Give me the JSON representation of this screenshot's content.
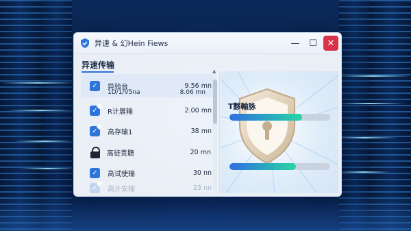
{
  "window": {
    "title": "异速 & 幻Hein Fiews",
    "controls": {
      "minimize": "—",
      "maximize": "☐",
      "close": "✕"
    }
  },
  "section": {
    "title": "异速传输"
  },
  "transfers": [
    {
      "label": "异验台",
      "value": "9.56 mn",
      "sub_label": "1D/1/V5na",
      "sub_value": "8.06 mn",
      "icon": "check-icon",
      "selected": true
    },
    {
      "label": "R计展输",
      "value": "2.00 mn",
      "icon": "document-check-icon"
    },
    {
      "label": "高存输1",
      "value": "38 mn",
      "icon": "document-check-icon"
    },
    {
      "label": "高徒责聽",
      "value": "20 mn",
      "icon": "lock-icon"
    },
    {
      "label": "高试使输",
      "value": "30 nn",
      "icon": "check-icon"
    },
    {
      "label": "高计安输",
      "value": "23 nn",
      "icon": "document-check-icon",
      "faded": true
    }
  ],
  "status": {
    "label": "T黟輸脉",
    "progress_top": 0.72,
    "progress_bottom": 0.66
  },
  "colors": {
    "accent": "#2d74db",
    "progress_start": "#2f6fe0",
    "progress_end": "#27d6a4",
    "close": "#d9334a"
  }
}
